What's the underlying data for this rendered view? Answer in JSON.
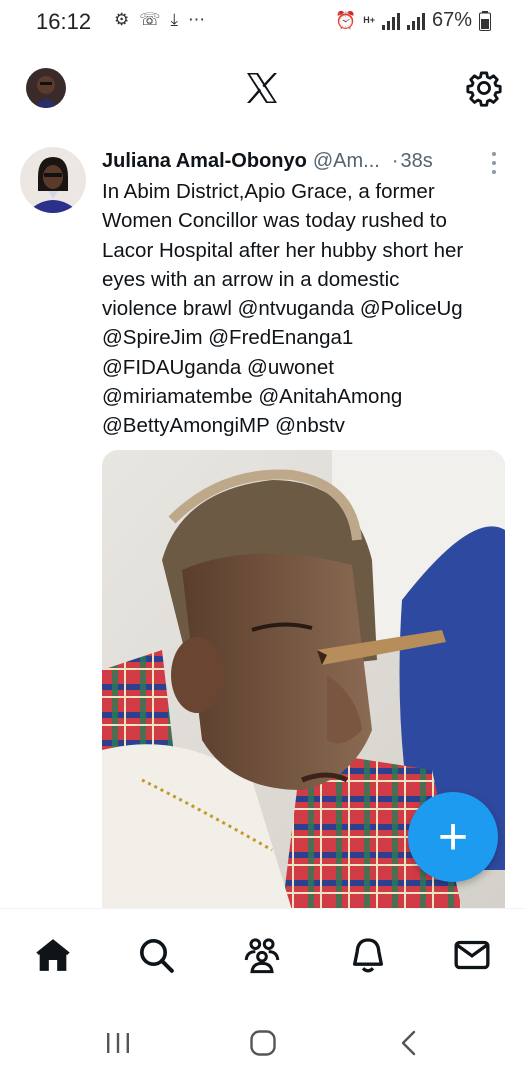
{
  "status_bar": {
    "time": "16:12",
    "network": "H+",
    "battery_percent": "67%",
    "notification_icons": [
      "settings-alt-icon",
      "whatsapp-icon",
      "download-icon",
      "more-dots-icon"
    ]
  },
  "header": {
    "logo": "X",
    "settings_icon": "gear-icon"
  },
  "tweet": {
    "author_name": "Juliana Amal-Obonyo",
    "author_handle": "@Am...",
    "time_separator": "·",
    "time": "38s",
    "text": "In Abim District,Apio Grace, a former\nWomen Concillor was today  rushed to\nLacor Hospital after her hubby short her\neyes with an arrow in a domestic\nviolence brawl @ntvuganda @PoliceUg\n@SpireJim @FredEnanga1\n@FIDAUganda @uwonet\n@miriamatembe @AnitahAmong\n@BettyAmongiMP @nbstv"
  },
  "fab": {
    "label": "+"
  },
  "bottom_nav": [
    "home-icon",
    "search-icon",
    "communities-icon",
    "notifications-icon",
    "messages-icon"
  ],
  "system_nav": [
    "recents-icon",
    "home-button-icon",
    "back-icon"
  ],
  "colors": {
    "accent": "#1d9bf0",
    "text": "#0f1419",
    "secondary": "#536471"
  }
}
